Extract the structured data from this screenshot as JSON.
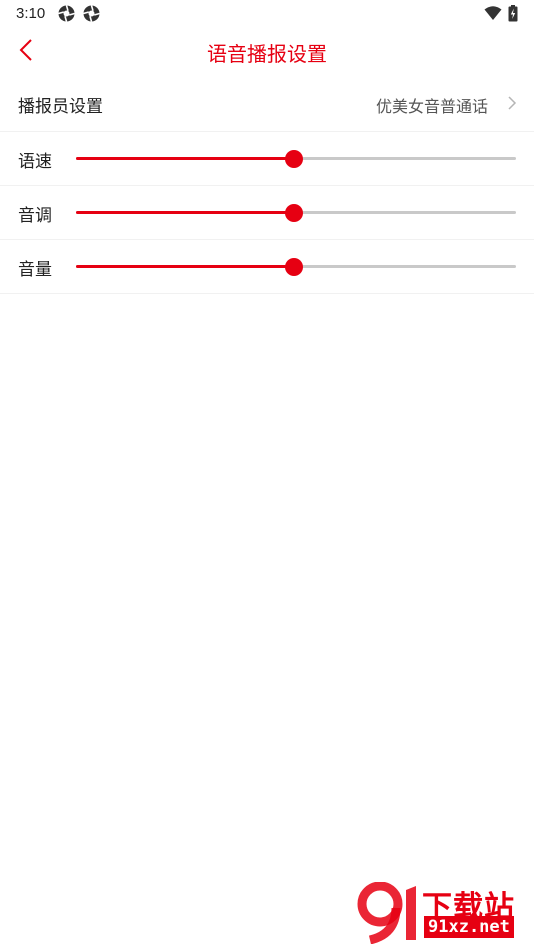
{
  "status_bar": {
    "time": "3:10",
    "notification_icons": [
      "aperture-icon",
      "aperture-icon"
    ],
    "right_icons": [
      "wifi-icon",
      "battery-charging-icon"
    ]
  },
  "header": {
    "back_icon": "chevron-left-icon",
    "title": "语音播报设置"
  },
  "settings": {
    "broadcaster": {
      "label": "播报员设置",
      "value": "优美女音普通话"
    },
    "sliders": [
      {
        "label": "语速",
        "level_percent": 49.5
      },
      {
        "label": "音调",
        "level_percent": 49.5
      },
      {
        "label": "音量",
        "level_percent": 49.5
      }
    ]
  },
  "watermark": {
    "title": "下载站",
    "url": "91xz.net"
  },
  "colors": {
    "accent": "#e60012",
    "track": "#c9c9c9",
    "text": "#222222",
    "secondary_text": "#555555",
    "background": "#ffffff"
  }
}
